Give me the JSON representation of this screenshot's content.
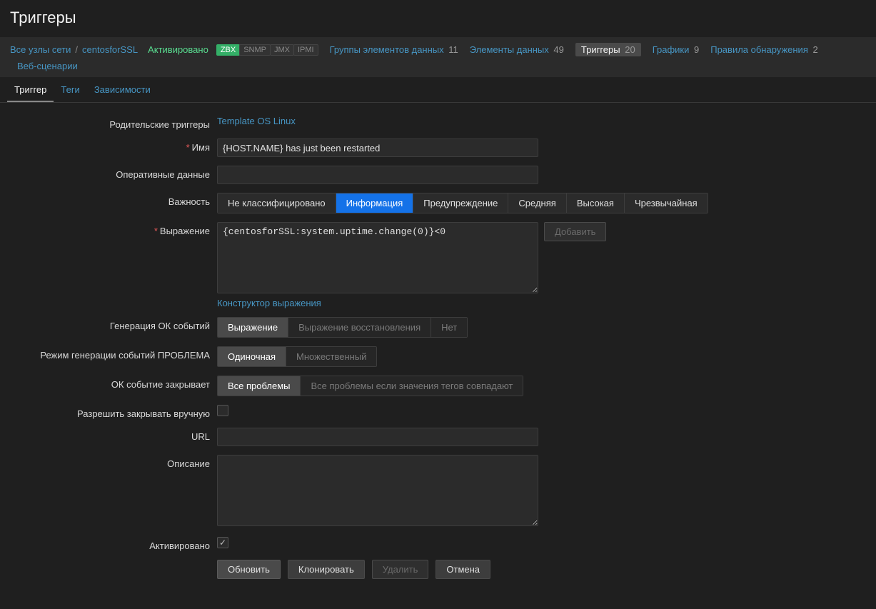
{
  "page_title": "Триггеры",
  "breadcrumb": {
    "all_hosts": "Все узлы сети",
    "host": "centosforSSL",
    "status": "Активировано",
    "ifaces": {
      "zbx": "ZBX",
      "snmp": "SNMP",
      "jmx": "JMX",
      "ipmi": "IPMI"
    },
    "nav": {
      "apps": {
        "label": "Группы элементов данных",
        "count": "11"
      },
      "items": {
        "label": "Элементы данных",
        "count": "49"
      },
      "trigs": {
        "label": "Триггеры",
        "count": "20"
      },
      "graphs": {
        "label": "Графики",
        "count": "9"
      },
      "disc": {
        "label": "Правила обнаружения",
        "count": "2"
      },
      "web": {
        "label": "Веб-сценарии"
      }
    }
  },
  "tabs": {
    "trigger": "Триггер",
    "tags": "Теги",
    "deps": "Зависимости"
  },
  "form": {
    "parent_label": "Родительские триггеры",
    "parent_value": "Template OS Linux",
    "name_label": "Имя",
    "name_value": "{HOST.NAME} has just been restarted",
    "opdata_label": "Оперативные данные",
    "opdata_value": "",
    "severity_label": "Важность",
    "severity_opts": [
      "Не классифицировано",
      "Информация",
      "Предупреждение",
      "Средняя",
      "Высокая",
      "Чрезвычайная"
    ],
    "expr_label": "Выражение",
    "expr_value": "{centosforSSL:system.uptime.change(0)}<0",
    "expr_add": "Добавить",
    "expr_ctor": "Конструктор выражения",
    "okgen_label": "Генерация ОК событий",
    "okgen_opts": [
      "Выражение",
      "Выражение восстановления",
      "Нет"
    ],
    "probmode_label": "Режим генерации событий ПРОБЛЕМА",
    "probmode_opts": [
      "Одиночная",
      "Множественный"
    ],
    "okclose_label": "ОК событие закрывает",
    "okclose_opts": [
      "Все проблемы",
      "Все проблемы если значения тегов совпадают"
    ],
    "manual_label": "Разрешить закрывать вручную",
    "url_label": "URL",
    "url_value": "",
    "desc_label": "Описание",
    "desc_value": "",
    "enabled_label": "Активировано",
    "buttons": {
      "update": "Обновить",
      "clone": "Клонировать",
      "delete": "Удалить",
      "cancel": "Отмена"
    }
  }
}
